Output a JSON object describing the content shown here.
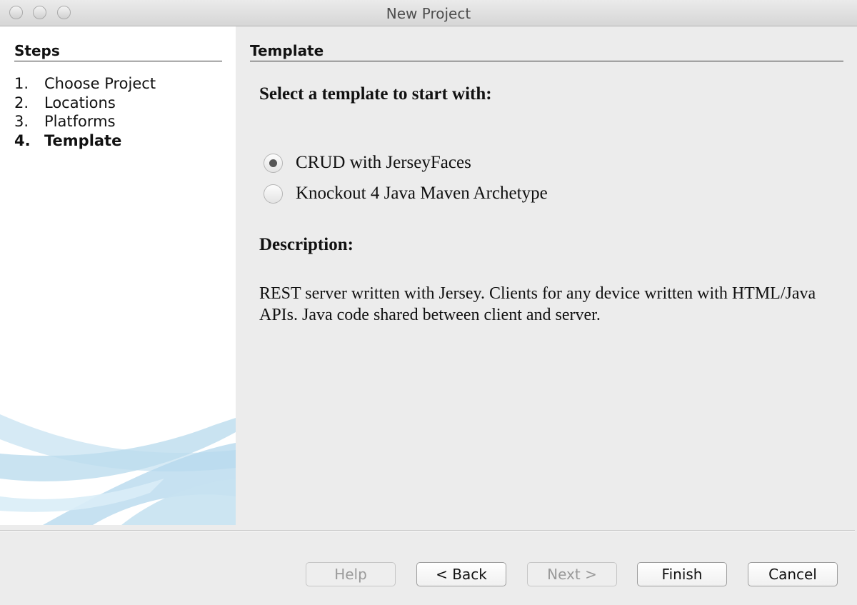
{
  "window": {
    "title": "New Project"
  },
  "sidebar": {
    "heading": "Steps",
    "steps": [
      {
        "num": "1.",
        "label": "Choose Project"
      },
      {
        "num": "2.",
        "label": "Locations"
      },
      {
        "num": "3.",
        "label": "Platforms"
      },
      {
        "num": "4.",
        "label": "Template"
      }
    ],
    "active_step": "Template"
  },
  "main": {
    "heading": "Template",
    "select_label": "Select a template to start with:",
    "templates": [
      {
        "label": "CRUD with JerseyFaces",
        "selected": true
      },
      {
        "label": "Knockout 4 Java Maven Archetype",
        "selected": false
      }
    ],
    "description_label": "Description:",
    "description": "REST server written with Jersey. Clients for any device written with HTML/Java APIs. Java code shared between client and server."
  },
  "buttons": {
    "help": {
      "label": "Help",
      "enabled": false
    },
    "back": {
      "label": "< Back",
      "enabled": true
    },
    "next": {
      "label": "Next >",
      "enabled": false
    },
    "finish": {
      "label": "Finish",
      "enabled": true
    },
    "cancel": {
      "label": "Cancel",
      "enabled": true
    }
  },
  "colors": {
    "sidebar_bg": "#ffffff",
    "panel_bg": "#ececec",
    "swoosh": "#bcdcee"
  }
}
